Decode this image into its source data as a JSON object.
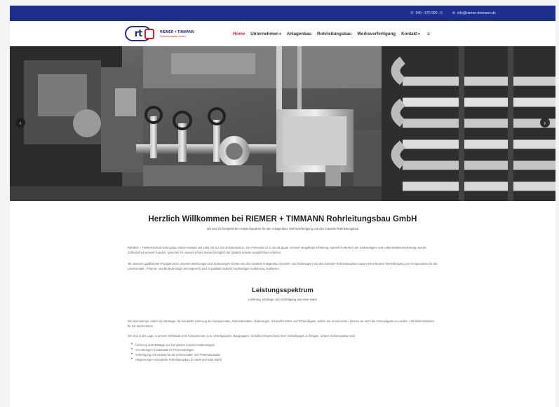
{
  "topbar": {
    "phone": "040 - 675 990 - 0",
    "email": "info@riemer-timmann.de"
  },
  "logo": {
    "mark": "rt",
    "line1": "RIEMER + TIMMANN",
    "line2": "Rohrleitungsbau GmbH"
  },
  "nav": {
    "items": [
      {
        "label": "Home"
      },
      {
        "label": "Unternehmen"
      },
      {
        "label": "Anlagenbau"
      },
      {
        "label": "Rohrleitungsbau"
      },
      {
        "label": "Werksvorfertigung"
      },
      {
        "label": "Kontakt"
      }
    ],
    "chevron": "▾",
    "menu_glyph": "≡"
  },
  "hero": {
    "prev_glyph": "‹",
    "next_glyph": "›"
  },
  "intro": {
    "title": "Herzlich Willkommen bei RIEMER + TIMMANN Rohrleitungsbau GmbH",
    "subtitle": "Wir sind Ihr kompetenter Ansprechpartner für den Anlagenbau, Werksvorfertigung und den industrie-Rohrleitungsbau",
    "para1": "RIEMER + TIMMANN Rohrleitungsbau GmbH existiert seit 1984 mit zur Zeit 30 Mitarbeitern. Der Firmensitz ist in 22145 Braak. Unserer langjährige Erfahrung, speziell im Bereich der Kälteanlagen- und Lebensmittelverarbeitung und die Zufriedenheit unserer Kunden, sprechen für unseres hohes Niveau bezüglich der Qualität unserer ausgeführten Arbeiten.",
    "para2": "Mit unserem qualifizierten Fachpersonal, unseren Werkzeugen und Zulassungen können wir den industrie Anlagenbau (Gesamt- und Teilanlagen) und den industrie-Rohrleitungsbau sowie eine exklusive Werksfertigung von Komponenten für die Lebensmittel-, Pharma- und Biotechnologie termingerecht und in qualitativ äußerst hochwertiger Ausführung realisieren."
  },
  "services": {
    "title": "Leistungsspektrum",
    "subtitle": "Lieferung, Montage und Vorfertigung aus einer Hand",
    "para1": "Wir übernehmen, neben der Montage, die komplette Lieferung der Komponenten, Rohrmaterialien, Halterungen, Schweißzusätze und Schweißgase. Sofern Sie es wünschen, können wir auch die Unteraufgabe von Isolier- und Elektroarbeiten für Sie übernehmen.",
    "para2": "Wir sind in der Lage, in unserer Werkstatt viele Komponenten (z.B. Verteilgruppen, Baugruppen, Umlufts) entsprechend Ihrer Vorstellungen zu fertigen. Unsere Schwerpunkte sind:",
    "list": [
      "Lieferung und Montage von kompletten Industrie-Kälteanlagen",
      "Verrohrungen in Edelstahl für Prozessanlagen",
      "Vorfertigung und Umbau für die Lebensmittel- und Pharmaindustrie",
      "Absperrungen Industrielle Rohrleitungsbau (C-Stahl und Edel Stahl)"
    ]
  }
}
